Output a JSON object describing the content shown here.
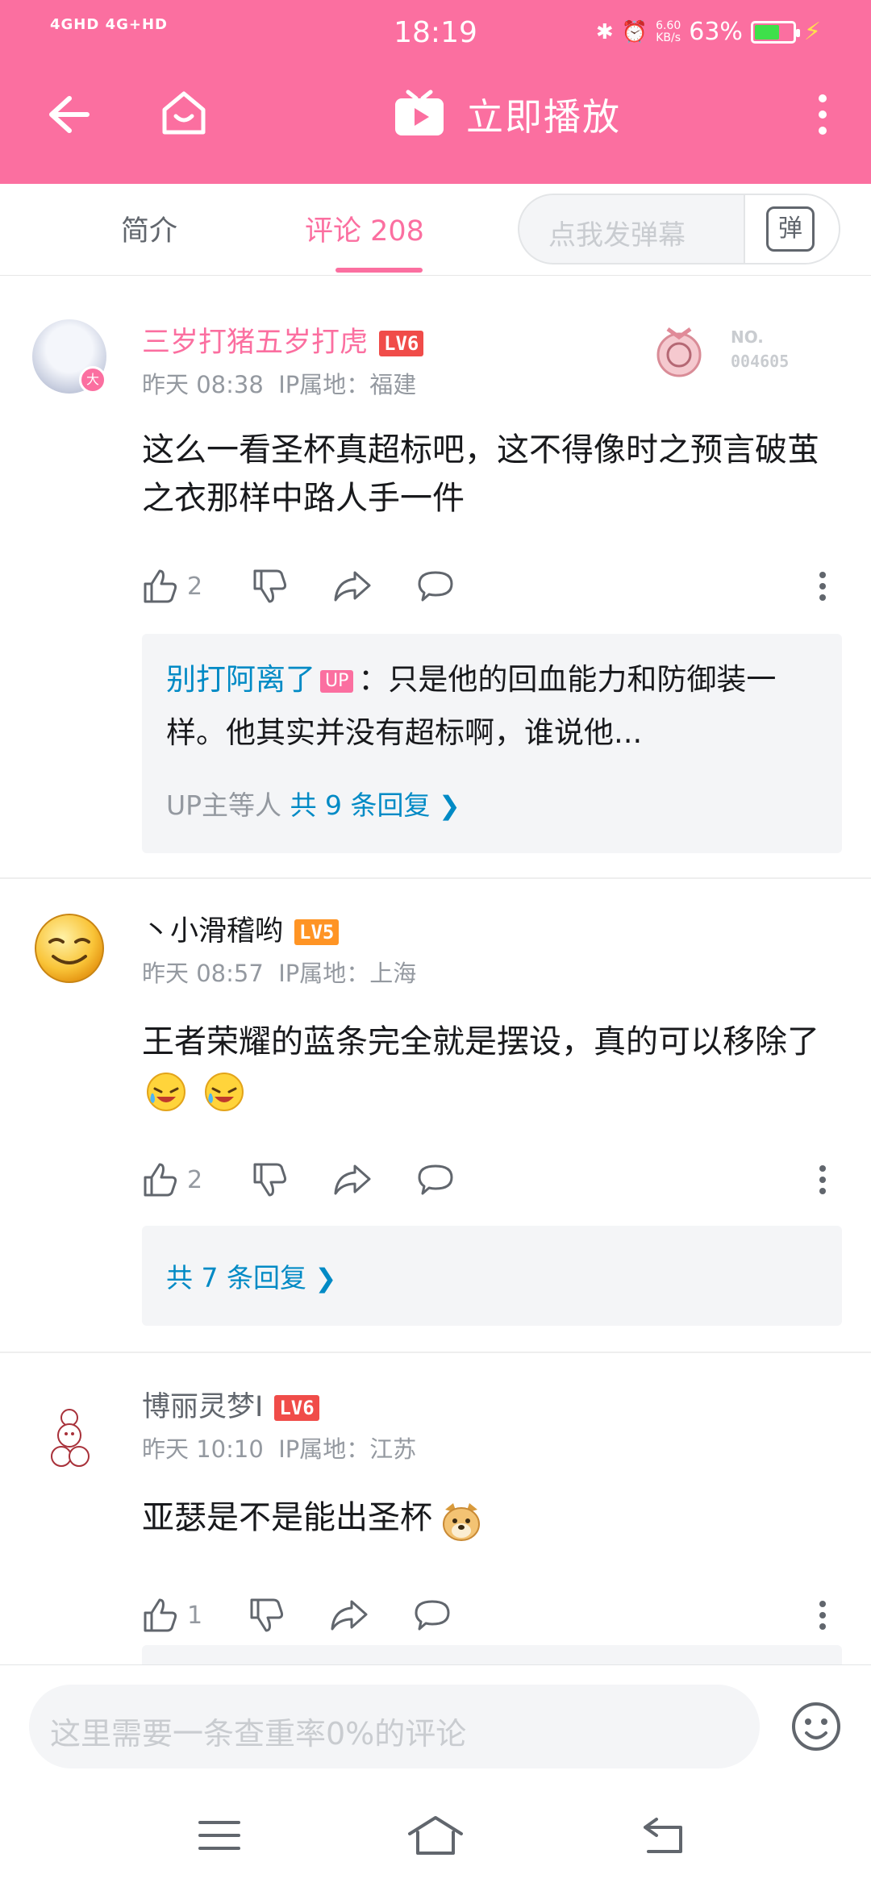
{
  "status_bar": {
    "signal_text": "4GHD 4G+HD",
    "time": "18:19",
    "net_speed": "6.60\nKB/s",
    "battery": "63%"
  },
  "header": {
    "title": "立即播放"
  },
  "tabs": {
    "intro": "简介",
    "comments": "评论 208",
    "danmaku_placeholder": "点我发弹幕",
    "danmaku_icon_char": "弹"
  },
  "comments": [
    {
      "user": "三岁打猪五岁打虎",
      "level": "LV6",
      "time": "昨天 08:38",
      "ip": "IP属地：福建",
      "badge_no": "NO.",
      "badge_num": "004605",
      "text": "这么一看圣杯真超标吧，这不得像时之预言破茧之衣那样中路人手一件",
      "likes": "2",
      "reply_user": "别打阿离了",
      "reply_tag": "UP",
      "reply_text": "：只是他的回血能力和防御装一样。他其实并没有超标啊，谁说他...",
      "reply_prefix": "UP主等人",
      "reply_count": "共 9 条回复"
    },
    {
      "user": "丶小滑稽哟",
      "level": "LV5",
      "time": "昨天 08:57",
      "ip": "IP属地：上海",
      "text": "王者荣耀的蓝条完全就是摆设，真的可以移除了",
      "likes": "2",
      "reply_count": "共 7 条回复"
    },
    {
      "user": "博丽灵梦I",
      "level": "LV6",
      "time": "昨天 10:10",
      "ip": "IP属地：江苏",
      "text": "亚瑟是不是能出圣杯",
      "likes": "1"
    }
  ],
  "bottom": {
    "input_placeholder": "这里需要一条查重率0%的评论"
  },
  "colors": {
    "brand": "#fb6fa0",
    "link": "#008ac5",
    "lv6": "#f04c49",
    "lv5": "#ff9424"
  }
}
